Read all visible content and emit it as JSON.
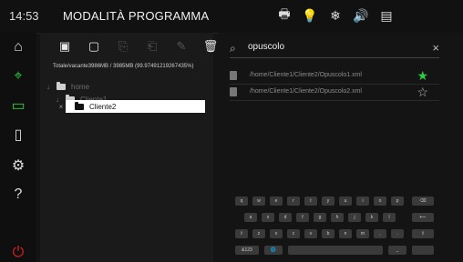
{
  "header": {
    "time": "14:53",
    "title": "MODALITÀ PROGRAMMA",
    "icons": [
      "printer-icon",
      "bulb-icon",
      "snowflake-icon",
      "speaker-icon",
      "usb-drive-icon"
    ]
  },
  "sidebar": {
    "items": [
      {
        "name": "home-icon"
      },
      {
        "name": "crosshair-icon"
      },
      {
        "name": "folder-icon",
        "active": true
      },
      {
        "name": "door-icon"
      },
      {
        "name": "settings-icon"
      },
      {
        "name": "help-icon"
      },
      {
        "name": "power-icon"
      }
    ]
  },
  "left_panel": {
    "space_text": "Totale/vacante3986MB / 3985MB (99.97491219267435%)",
    "toolbar_icons": [
      {
        "name": "new-folder-icon",
        "enabled": true
      },
      {
        "name": "new-file-icon",
        "enabled": true
      },
      {
        "name": "copy-icon",
        "enabled": false
      },
      {
        "name": "paste-icon",
        "enabled": false
      },
      {
        "name": "rename-icon",
        "enabled": false
      },
      {
        "name": "delete-icon",
        "enabled": true
      }
    ],
    "tree": [
      {
        "label": "home",
        "expanded": true,
        "indent": 0
      },
      {
        "label": "Cliente1",
        "expanded": true,
        "indent": 1
      },
      {
        "label": "Cliente2",
        "selected": true,
        "indent": 2
      }
    ]
  },
  "right_panel": {
    "search_value": "opuscolo",
    "results": [
      {
        "path": "/home/Cliente1/Cliente2/Opuscolo1.xml",
        "favorite": true
      },
      {
        "path": "/home/Cliente1/Cliente2/Opuscolo2.xml",
        "favorite": false
      }
    ]
  },
  "keyboard": {
    "row1": [
      "q",
      "w",
      "e",
      "r",
      "t",
      "y",
      "u",
      "i",
      "o",
      "p",
      "⌫"
    ],
    "row2": [
      "a",
      "s",
      "d",
      "f",
      "g",
      "h",
      "j",
      "k",
      "l",
      "⟵"
    ],
    "row3": [
      "⇧",
      "z",
      "x",
      "c",
      "v",
      "b",
      "n",
      "m",
      ",",
      ".",
      "⇧"
    ],
    "row4": [
      "&123",
      "🌐",
      "",
      "_",
      ""
    ]
  },
  "colors": {
    "accent_green": "#2ecc40",
    "danger_red": "#e02020",
    "background": "#141414"
  }
}
